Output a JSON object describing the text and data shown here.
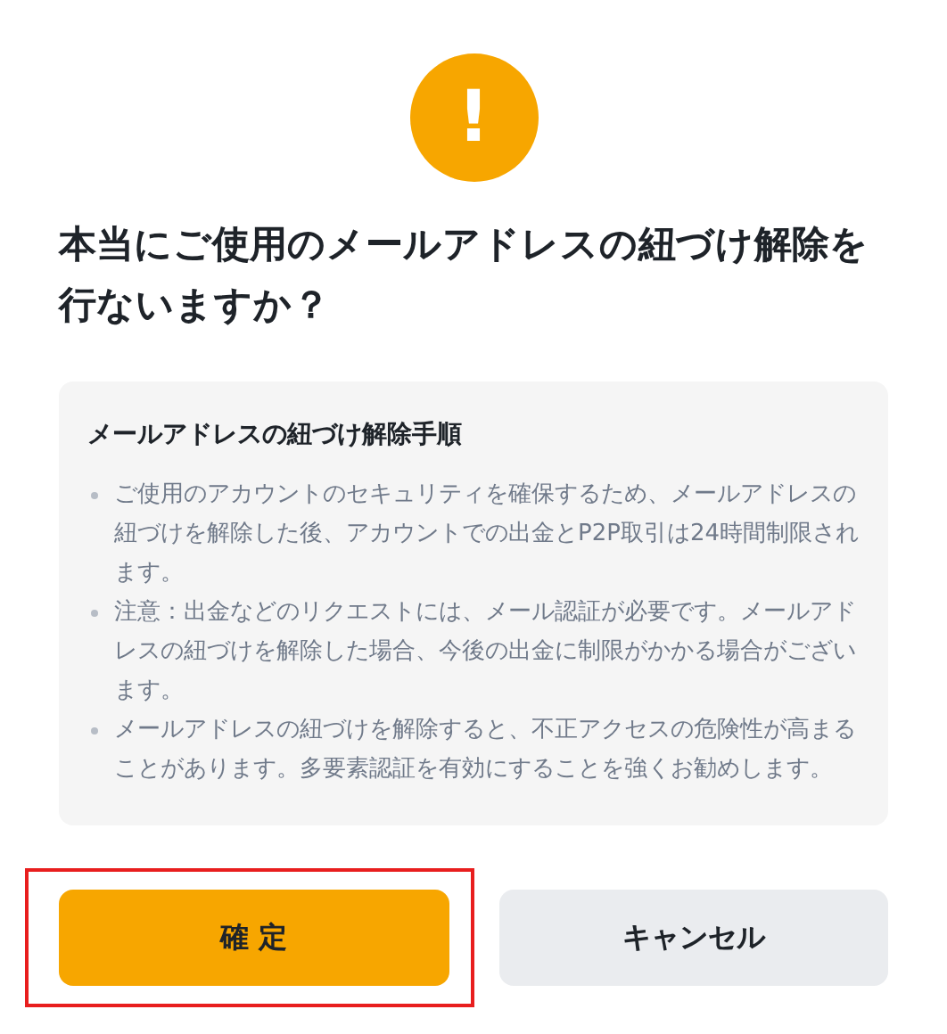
{
  "icon": {
    "glyph": "!"
  },
  "title": "本当にご使用のメールアドレスの紐づけ解除を行ないますか？",
  "notice": {
    "heading": "メールアドレスの紐づけ解除手順",
    "items": [
      "ご使用のアカウントのセキュリティを確保するため、メールアドレスの紐づけを解除した後、アカウントでの出金とP2P取引は24時間制限されます。",
      "注意：出金などのリクエストには、メール認証が必要です。メールアドレスの紐づけを解除した場合、今後の出金に制限がかかる場合がございます。",
      "メールアドレスの紐づけを解除すると、不正アクセスの危険性が高まることがあります。多要素認証を有効にすることを強くお勧めします。"
    ]
  },
  "buttons": [
    {
      "label": "確 定",
      "kind": "primary",
      "highlighted": true
    },
    {
      "label": "キャンセル",
      "kind": "secondary",
      "highlighted": false
    }
  ]
}
